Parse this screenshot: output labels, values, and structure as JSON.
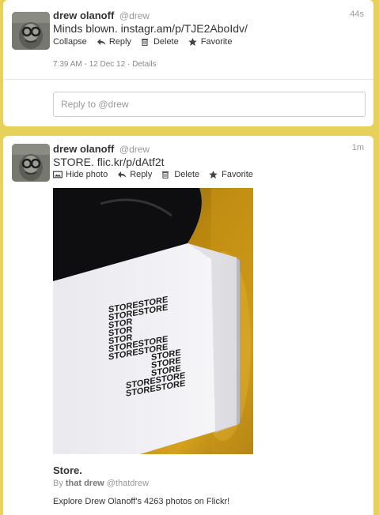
{
  "tweets": [
    {
      "author_name": "drew olanoff",
      "author_handle": "@drew",
      "time": "44s",
      "text": "Minds blown. instagr.am/p/TJE2AboIdv/",
      "actions": {
        "first": "Collapse",
        "reply": "Reply",
        "delete": "Delete",
        "favorite": "Favorite"
      },
      "meta_time": "7:39 AM - 12 Dec 12",
      "meta_sep": "·",
      "meta_details": "Details",
      "reply_placeholder": "Reply to @drew"
    },
    {
      "author_name": "drew olanoff",
      "author_handle": "@drew",
      "time": "1m",
      "text": "STORE. flic.kr/p/dAtf2t",
      "actions": {
        "first": "Hide photo",
        "reply": "Reply",
        "delete": "Delete",
        "favorite": "Favorite"
      },
      "card": {
        "title": "Store.",
        "by_label": "By",
        "by_name": "that drew",
        "by_handle": "@thatdrew",
        "description": "Explore Drew Olanoff's 4263 photos on Flickr!"
      }
    }
  ],
  "colors": {
    "background": "#e6d25a",
    "text": "#333333",
    "muted": "#999999"
  },
  "icons": {
    "reply": "reply-arrow-icon",
    "delete": "trash-icon",
    "favorite": "star-icon",
    "hide_photo": "photo-icon"
  }
}
